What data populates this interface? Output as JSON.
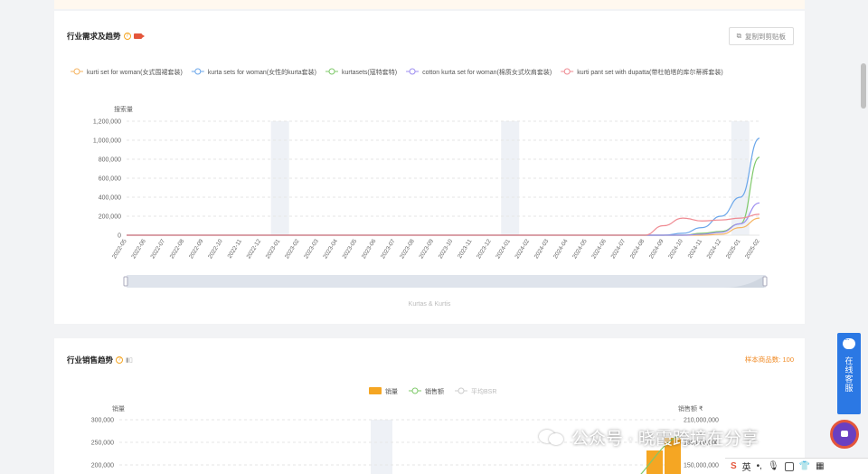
{
  "card1": {
    "title": "行业需求及趋势",
    "copy_button": "复制到剪贴板",
    "brand_label": "Kurtas & Kurtis"
  },
  "card2": {
    "title": "行业销售趋势",
    "sample_count": "样本商品数: 100"
  },
  "service": {
    "label": "在线客服"
  },
  "watermark": {
    "text": "公众号 · 晓霞跨境在分享"
  },
  "taskbar": {
    "ime": "英"
  },
  "chart_data": [
    {
      "type": "line",
      "ylabel": "搜索量",
      "ylim": [
        0,
        1200000
      ],
      "yticks": [
        "1,200,000",
        "1,000,000",
        "800,000",
        "600,000",
        "400,000",
        "200,000",
        "0"
      ],
      "categories": [
        "2022-05",
        "2022-06",
        "2022-07",
        "2022-08",
        "2022-09",
        "2022-10",
        "2022-11",
        "2022-12",
        "2023-01",
        "2023-02",
        "2023-03",
        "2023-04",
        "2023-05",
        "2023-06",
        "2023-07",
        "2023-08",
        "2023-09",
        "2023-10",
        "2023-11",
        "2023-12",
        "2024-01",
        "2024-02",
        "2024-03",
        "2024-04",
        "2024-05",
        "2024-06",
        "2024-07",
        "2024-08",
        "2024-09",
        "2024-10",
        "2024-11",
        "2024-12",
        "2025-01",
        "2025-02"
      ],
      "highlight_months": [
        "2023-01",
        "2024-01",
        "2025-01"
      ],
      "legend_position": "top",
      "series": [
        {
          "name": "kurti set for woman(女式围裙套装)",
          "color": "#f5b461",
          "values": [
            0,
            0,
            0,
            0,
            0,
            0,
            0,
            0,
            0,
            0,
            0,
            0,
            0,
            0,
            0,
            0,
            0,
            0,
            0,
            0,
            0,
            0,
            0,
            0,
            0,
            0,
            0,
            0,
            0,
            0,
            0,
            10000,
            80000,
            180000
          ]
        },
        {
          "name": "kurta sets for woman(女性的kurta套装)",
          "color": "#6aa6ea",
          "values": [
            0,
            0,
            0,
            0,
            0,
            0,
            0,
            0,
            0,
            0,
            0,
            0,
            0,
            0,
            0,
            0,
            0,
            0,
            0,
            0,
            0,
            0,
            0,
            0,
            0,
            0,
            0,
            0,
            0,
            20000,
            80000,
            200000,
            400000,
            1020000
          ]
        },
        {
          "name": "kurtasets(寇特套特)",
          "color": "#7fc96a",
          "values": [
            0,
            0,
            0,
            0,
            0,
            0,
            0,
            0,
            0,
            0,
            0,
            0,
            0,
            0,
            0,
            0,
            0,
            0,
            0,
            0,
            0,
            0,
            0,
            0,
            0,
            0,
            0,
            0,
            0,
            0,
            20000,
            40000,
            120000,
            820000
          ]
        },
        {
          "name": "cotton kurta set for woman(棉质女式坎肩套装)",
          "color": "#9d8df0",
          "values": [
            0,
            0,
            0,
            0,
            0,
            0,
            0,
            0,
            0,
            0,
            0,
            0,
            0,
            0,
            0,
            0,
            0,
            0,
            0,
            0,
            0,
            0,
            0,
            0,
            0,
            0,
            0,
            0,
            0,
            0,
            10000,
            30000,
            120000,
            340000
          ]
        },
        {
          "name": "kurti pant set with dupatta(带杜帕塔的库尔蒂裤套装)",
          "color": "#ef8a92",
          "values": [
            0,
            0,
            0,
            0,
            0,
            0,
            0,
            0,
            0,
            0,
            0,
            0,
            0,
            0,
            0,
            0,
            0,
            0,
            0,
            0,
            0,
            0,
            0,
            0,
            0,
            0,
            0,
            0,
            100000,
            180000,
            150000,
            160000,
            180000,
            220000
          ]
        }
      ]
    },
    {
      "type": "bar",
      "legend": [
        {
          "name": "销量",
          "color": "#f5a623",
          "kind": "bar"
        },
        {
          "name": "销售额",
          "color": "#7fc96a",
          "kind": "line"
        },
        {
          "name": "平均BSR",
          "color": "#cccccc",
          "kind": "line"
        }
      ],
      "ylabel_left": "销量",
      "ylabel_right": "销售额 ₹",
      "yticks_left": [
        "300,000",
        "250,000",
        "200,000"
      ],
      "yticks_right": [
        "210,000,000",
        "180,000,000",
        "150,000,000"
      ]
    }
  ]
}
